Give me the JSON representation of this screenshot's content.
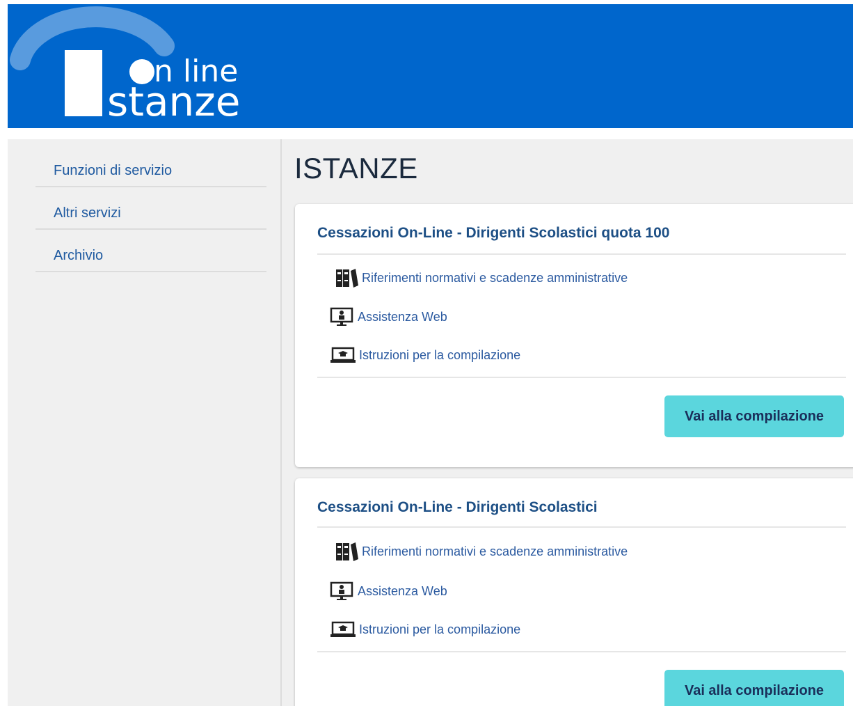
{
  "header": {
    "logo_top": "n line",
    "logo_bottom": "stanze",
    "colors": {
      "background": "#0066cc",
      "logo": "#ffffff"
    }
  },
  "sidebar": {
    "items": [
      {
        "label": "Funzioni di servizio"
      },
      {
        "label": "Altri servizi"
      },
      {
        "label": "Archivio"
      }
    ]
  },
  "main": {
    "title": "ISTANZE",
    "cards": [
      {
        "title": "Cessazioni On-Line - Dirigenti Scolastici quota 100",
        "links": [
          {
            "icon": "binders-icon",
            "label": "Riferimenti normativi e scadenze amministrative"
          },
          {
            "icon": "web-assistance-icon",
            "label": "Assistenza Web"
          },
          {
            "icon": "instructions-icon",
            "label": "Istruzioni per la compilazione"
          }
        ],
        "button": "Vai alla compilazione"
      },
      {
        "title": "Cessazioni On-Line - Dirigenti Scolastici",
        "links": [
          {
            "icon": "binders-icon",
            "label": "Riferimenti normativi e scadenze amministrative"
          },
          {
            "icon": "web-assistance-icon",
            "label": "Assistenza Web"
          },
          {
            "icon": "instructions-icon",
            "label": "Istruzioni per la compilazione"
          }
        ],
        "button": "Vai alla compilazione"
      }
    ]
  },
  "colors": {
    "link": "#2b5aa0",
    "card_title": "#1d4f85",
    "button_bg": "#5bd6dd",
    "page_bg": "#f0f0f0"
  }
}
